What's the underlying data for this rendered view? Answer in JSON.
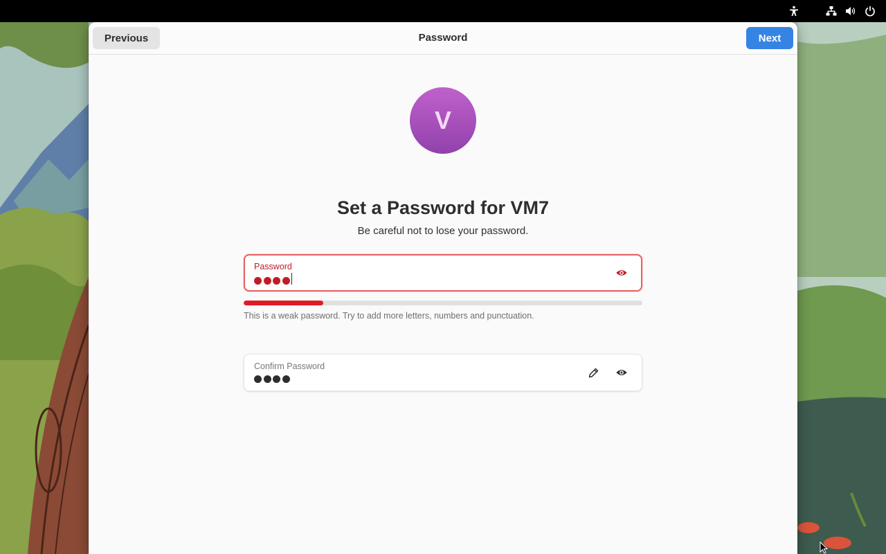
{
  "window": {
    "title": "Password",
    "previous_label": "Previous",
    "next_label": "Next"
  },
  "avatar": {
    "initial": "V",
    "gradient": [
      "#c061cb",
      "#9141ac"
    ]
  },
  "heading": {
    "title": "Set a Password for VM7",
    "subtitle": "Be careful not to lose your password."
  },
  "password_field": {
    "label": "Password",
    "masked_length": 4,
    "state": "error",
    "toggle_icon": "eye-icon"
  },
  "strength": {
    "level": 0.2,
    "hint": "This is a weak password. Try to add more letters, numbers and punctuation.",
    "color": "#e01b24"
  },
  "confirm_field": {
    "label": "Confirm Password",
    "masked_length": 4,
    "edit_icon": "pencil-icon",
    "toggle_icon": "eye-icon"
  },
  "system_tray": {
    "icons": [
      "accessibility-icon",
      "network-icon",
      "volume-icon",
      "power-icon"
    ]
  },
  "colors": {
    "accent": "#3584e4",
    "error": "#c01c28",
    "topbar": "#000000"
  }
}
